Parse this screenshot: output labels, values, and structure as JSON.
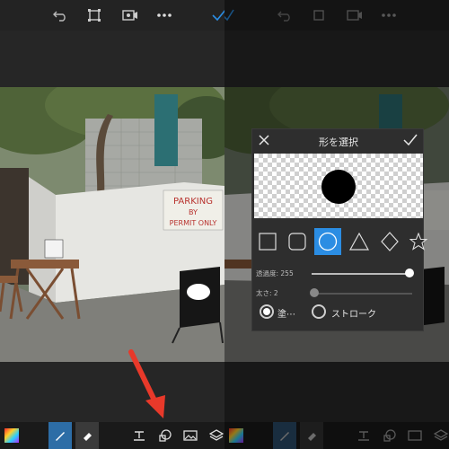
{
  "photo": {
    "sign_line1": "PARKING",
    "sign_line2": "BY",
    "sign_line3": "PERMIT ONLY"
  },
  "icons": {
    "undo": "undo-icon",
    "crop": "crop-icon",
    "video": "video-icon",
    "more": "more-icon",
    "check": "check-icon",
    "close": "close-icon"
  },
  "dialog": {
    "title": "形を選択",
    "opacity_label": "透過度: 255",
    "opacity_value": 255,
    "thickness_label": "太さ: 2",
    "thickness_value": 2,
    "fill_label": "塗⋯",
    "stroke_label": "ストローク",
    "shapes": [
      "square",
      "rounded-square",
      "circle",
      "triangle",
      "diamond",
      "star"
    ],
    "selected_shape": "circle"
  },
  "colors": {
    "accent": "#2b8de3",
    "arrow": "#e8392a"
  }
}
